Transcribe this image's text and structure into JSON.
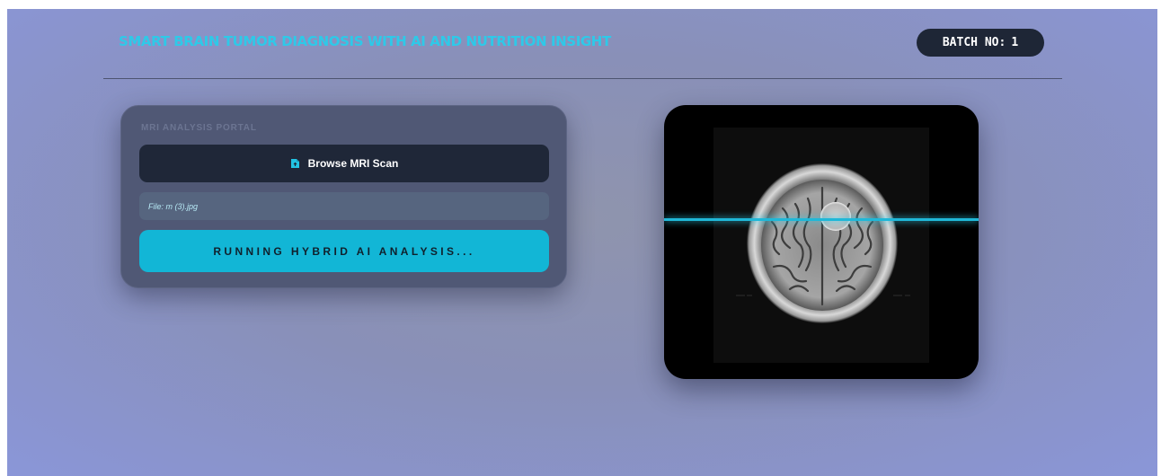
{
  "header": {
    "title": "SMART BRAIN TUMOR DIAGNOSIS WITH AI AND NUTRITION INSIGHT",
    "batch_label": "BATCH NO:",
    "batch_number": "1"
  },
  "portal": {
    "label": "MRI ANALYSIS PORTAL",
    "browse_label": "Browse MRI Scan",
    "browse_icon": "file-upload-icon",
    "file_text": "File: m (3).jpg",
    "run_label": "RUNNING HYBRID AI ANALYSIS..."
  },
  "preview": {
    "image": "brain-mri-scan",
    "scan_line": "scanning-indicator"
  },
  "colors": {
    "accent": "#12b6d6",
    "title": "#2ec9e8",
    "dark": "#1f2738"
  }
}
